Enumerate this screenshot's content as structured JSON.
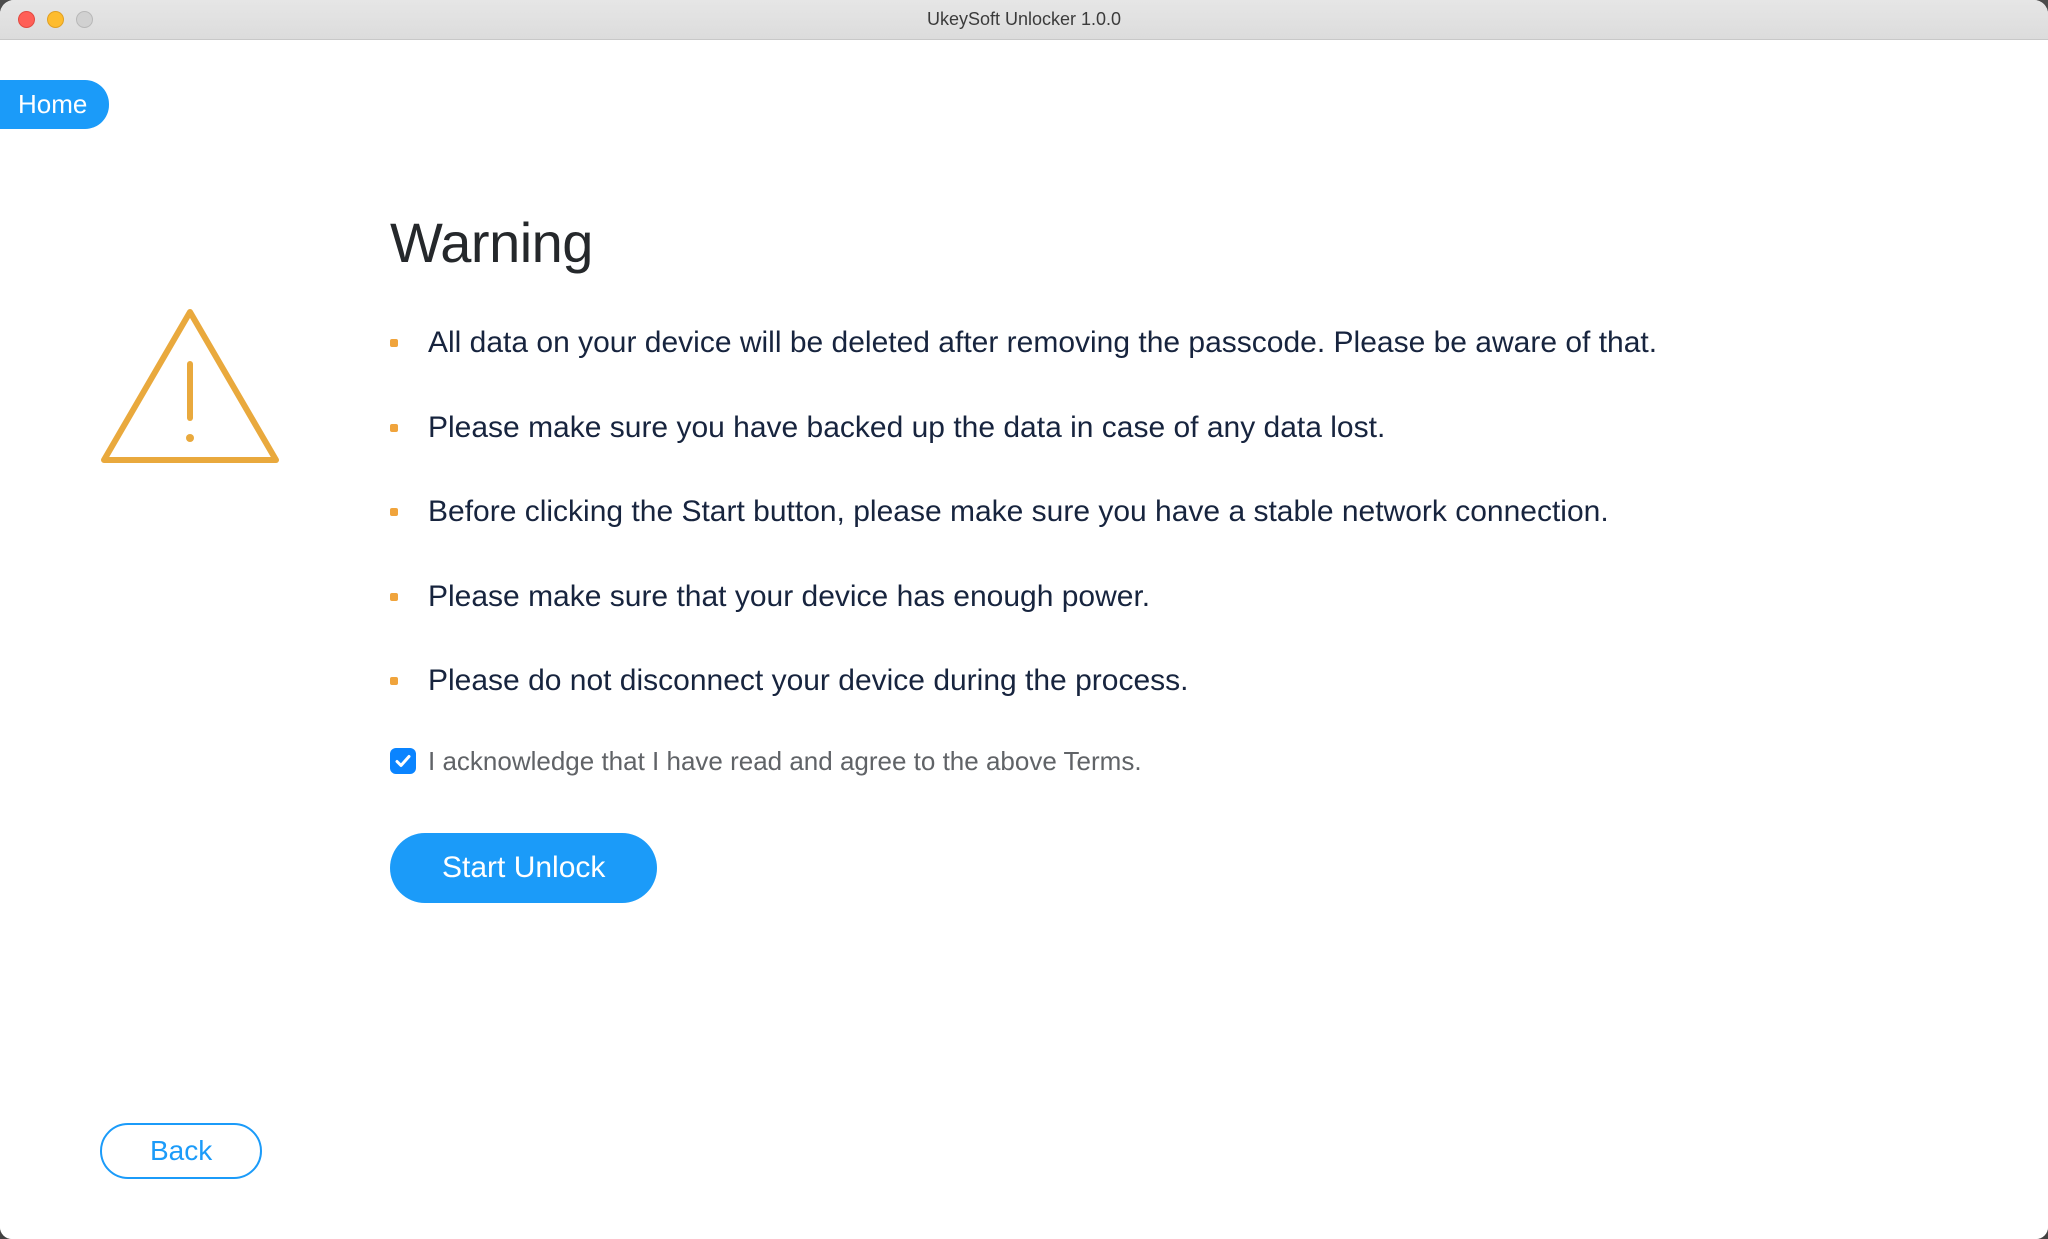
{
  "window": {
    "title": "UkeySoft Unlocker 1.0.0"
  },
  "nav": {
    "home_label": "Home",
    "back_label": "Back"
  },
  "warning": {
    "heading": "Warning",
    "bullets": [
      "All data on your device will be deleted after removing the passcode. Please be aware of that.",
      "Please make sure you have backed up the data in case of any data lost.",
      "Before clicking the Start button, please make sure you have a stable network connection.",
      "Please make sure that your device has enough power.",
      "Please do not disconnect your device during the process."
    ],
    "acknowledge_label": "I acknowledge that I have read and agree to the above Terms.",
    "acknowledge_checked": true,
    "start_button_label": "Start Unlock"
  },
  "colors": {
    "accent": "#1b9bf9",
    "warning_icon": "#e9a93d",
    "bullet": "#f0a43c",
    "text_dark": "#17243e"
  }
}
